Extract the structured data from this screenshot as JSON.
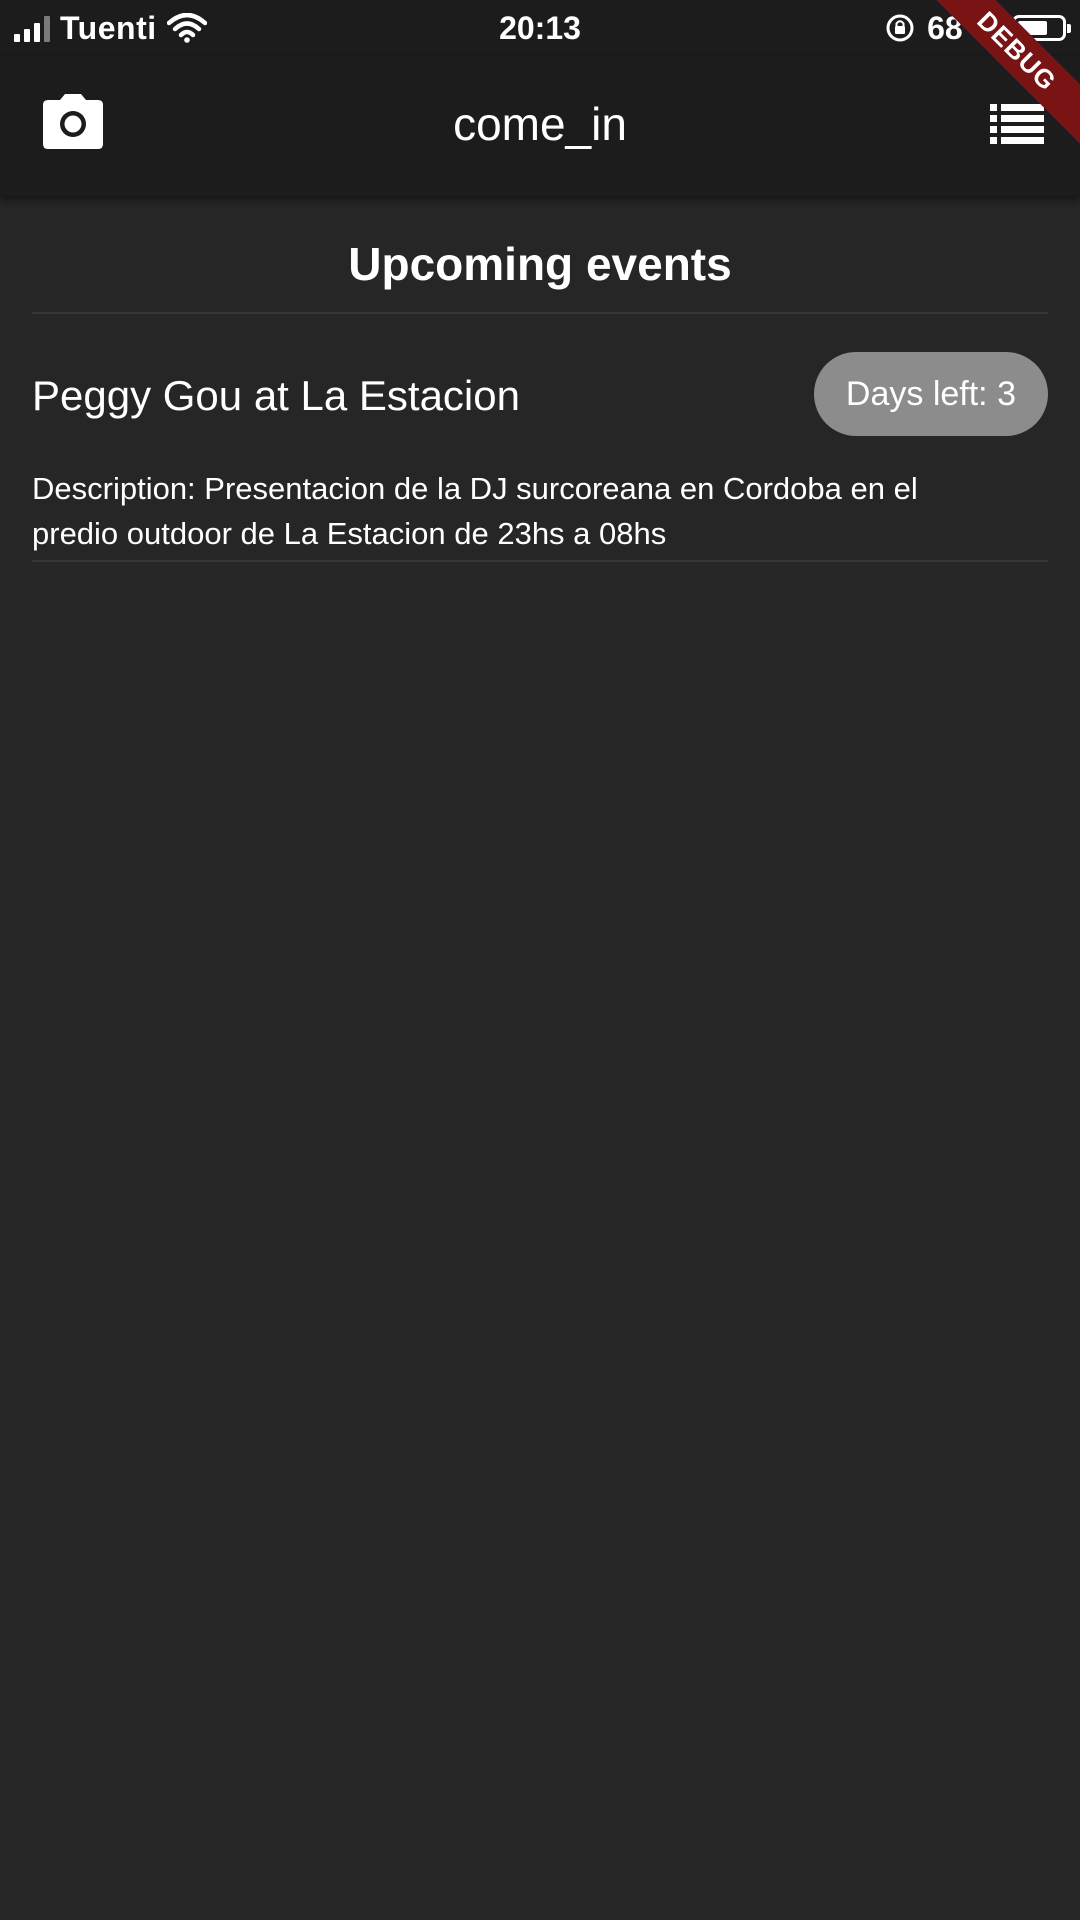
{
  "status_bar": {
    "carrier": "Tuenti",
    "time": "20:13",
    "battery_percent": "68 %",
    "battery_level": 0.68
  },
  "debug_banner": "DEBUG",
  "app_bar": {
    "title": "come_in",
    "left_icon": "camera-icon",
    "right_icon": "list-icon"
  },
  "page": {
    "heading": "Upcoming events"
  },
  "events": [
    {
      "title": "Peggy Gou at La Estacion",
      "days_left": "Days left: 3",
      "description": "Description: Presentacion de la DJ surcoreana en Cordoba en el predio outdoor de La Estacion de 23hs a 08hs"
    }
  ],
  "colors": {
    "background": "#262626",
    "app_bar": "#1c1c1c",
    "badge": "#8c8c8c",
    "debug_ribbon": "#7a1414",
    "text": "#ffffff"
  }
}
